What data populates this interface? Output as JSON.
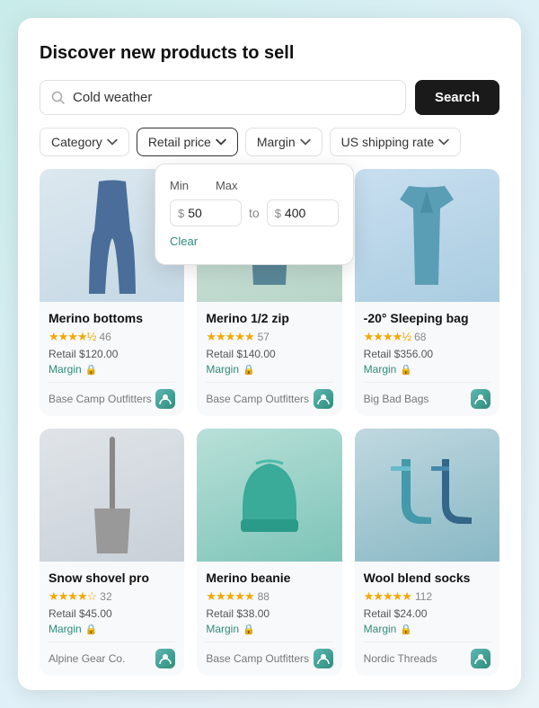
{
  "page": {
    "title": "Discover new products to sell"
  },
  "search": {
    "placeholder": "Cold weather",
    "value": "Cold weather",
    "button_label": "Search"
  },
  "filters": {
    "category_label": "Category",
    "retail_price_label": "Retail price",
    "margin_label": "Margin",
    "shipping_label": "US shipping rate",
    "dropdown": {
      "min_label": "Min",
      "max_label": "Max",
      "min_value": "50",
      "max_value": "400",
      "dollar_symbol": "$",
      "to_text": "to",
      "clear_label": "Clear"
    }
  },
  "products": [
    {
      "name": "Merino bottoms",
      "stars": "★★★★½",
      "reviews": "46",
      "retail": "Retail $120.00",
      "margin_label": "Margin",
      "supplier": "Base Camp Outfitters",
      "img_class": "img-leggings"
    },
    {
      "name": "Merino 1/2 zip",
      "stars": "★★★★★",
      "reviews": "57",
      "retail": "Retail $140.00",
      "margin_label": "Margin",
      "supplier": "Base Camp Outfitters",
      "img_class": "img-top"
    },
    {
      "name": "-20° Sleeping bag",
      "stars": "★★★★½",
      "reviews": "68",
      "retail": "Retail $356.00",
      "margin_label": "Margin",
      "supplier": "Big Bad Bags",
      "img_class": "img-vest"
    },
    {
      "name": "Snow shovel pro",
      "stars": "★★★★☆",
      "reviews": "32",
      "retail": "Retail $45.00",
      "margin_label": "Margin",
      "supplier": "Alpine Gear Co.",
      "img_class": "img-tool"
    },
    {
      "name": "Merino beanie",
      "stars": "★★★★★",
      "reviews": "88",
      "retail": "Retail $38.00",
      "margin_label": "Margin",
      "supplier": "Base Camp Outfitters",
      "img_class": "img-beanie"
    },
    {
      "name": "Wool blend socks",
      "stars": "★★★★★",
      "reviews": "112",
      "retail": "Retail $24.00",
      "margin_label": "Margin",
      "supplier": "Nordic Threads",
      "img_class": "img-socks"
    }
  ],
  "icons": {
    "search": "🔍",
    "chevron": "▾",
    "lock": "🔒",
    "supplier_badge": "S"
  }
}
